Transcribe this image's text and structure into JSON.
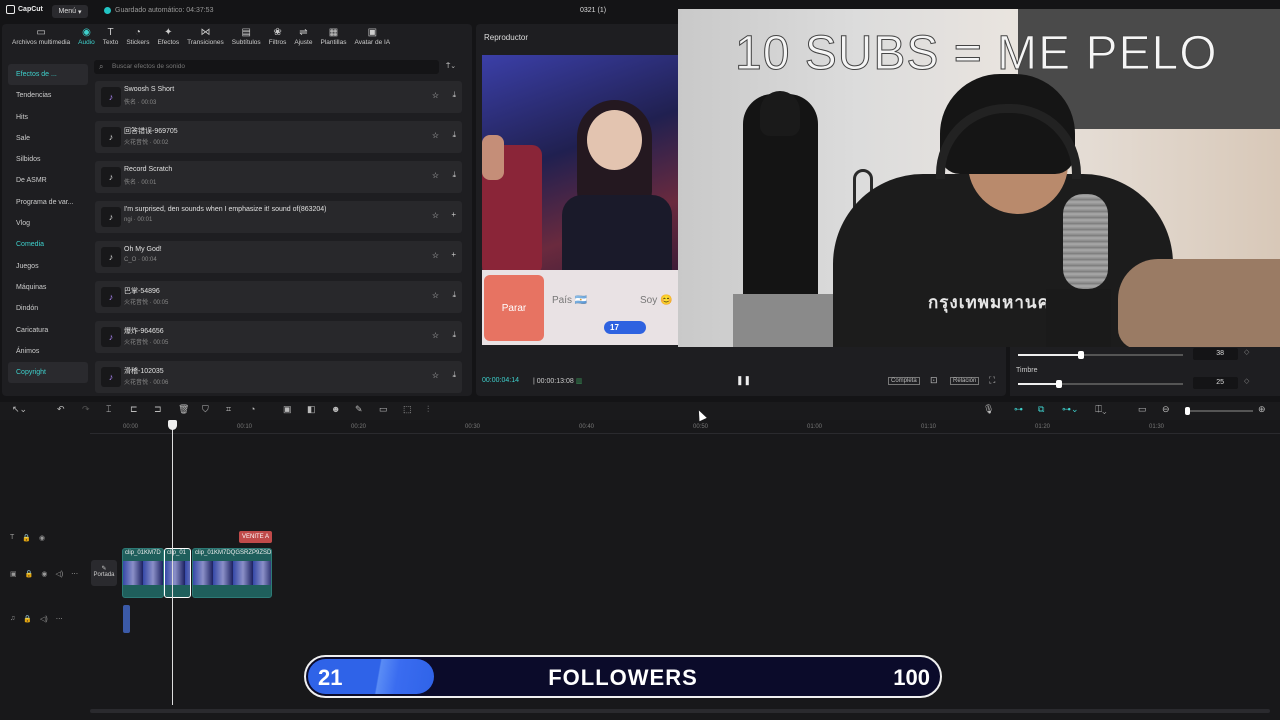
{
  "app": {
    "logo": "CapCut",
    "menu_label": "Menú",
    "autosave": "Guardado automático: 04:37:53",
    "project_name": "0321 (1)"
  },
  "tools": [
    {
      "label": "Archivos multimedia",
      "icon": "media-icon"
    },
    {
      "label": "Audio",
      "icon": "audio-icon"
    },
    {
      "label": "Texto",
      "icon": "text-icon"
    },
    {
      "label": "Stickers",
      "icon": "sticker-icon"
    },
    {
      "label": "Efectos",
      "icon": "effects-icon"
    },
    {
      "label": "Transiciones",
      "icon": "transition-icon"
    },
    {
      "label": "Subtítulos",
      "icon": "subtitle-icon"
    },
    {
      "label": "Filtros",
      "icon": "filter-icon"
    },
    {
      "label": "Ajuste",
      "icon": "adjust-icon"
    },
    {
      "label": "Plantillas",
      "icon": "template-icon"
    },
    {
      "label": "Avatar de IA",
      "icon": "avatar-icon"
    }
  ],
  "categories": [
    "Efectos de ...",
    "Tendencias",
    "Hits",
    "Sale",
    "Silbidos",
    "De ASMR",
    "Programa de var...",
    "Vlog",
    "Comedia",
    "Juegos",
    "Máquinas",
    "Dindón",
    "Caricatura",
    "Ánimos",
    "Copyright"
  ],
  "search_placeholder": "Buscar efectos de sonido",
  "sounds": [
    {
      "name": "Swoosh S Short",
      "meta": "佚名 · 00:03",
      "action": "download"
    },
    {
      "name": "回答错误-969705",
      "meta": "火花音悦 · 00:02",
      "action": "download"
    },
    {
      "name": "Record Scratch",
      "meta": "佚名 · 00:01",
      "action": "download"
    },
    {
      "name": "I'm surprised, den sounds when I emphasize it! sound of(863204)",
      "meta": "ngi · 00:01",
      "action": "add"
    },
    {
      "name": "Oh My God!",
      "meta": "C_O · 00:04",
      "action": "add"
    },
    {
      "name": "巴掌-54896",
      "meta": "火花音悦 · 00:05",
      "action": "download"
    },
    {
      "name": "爆炸-964656",
      "meta": "火花音悦 · 00:05",
      "action": "download"
    },
    {
      "name": "滑稽-102035",
      "meta": "火花音悦 · 00:06",
      "action": "download"
    }
  ],
  "player": {
    "title": "Reproductor",
    "current_time": "00:00:04:14",
    "total_time": "00:00:13:08",
    "btn_full": "Completa",
    "btn_ratio": "Relación",
    "video_buttons": {
      "stop": "Parar",
      "country": "País 🇦🇷",
      "soy": "Soy 😊",
      "counter": "17"
    }
  },
  "overlay_text": "10 SUBS = ME PELO",
  "shirt_text": "กรุงเทพมหานคร",
  "properties": {
    "value1": "38",
    "timbre_label": "Timbre",
    "value2": "25",
    "value1_fraction": 0.38,
    "value2_fraction": 0.25
  },
  "ruler": [
    "00:00",
    "00:10",
    "00:20",
    "00:30",
    "00:40",
    "00:50",
    "01:00",
    "01:10",
    "01:20",
    "01:30"
  ],
  "timeline": {
    "cover_label": "Portada",
    "text_clip": "VENITE A",
    "clips": [
      "clip_01KM7D",
      "clip_01",
      "clip_01KM7DQGSRZP9ZSD"
    ]
  },
  "followers": {
    "current": "21",
    "label": "FOLLOWERS",
    "goal": "100",
    "progress": 0.21
  },
  "colors": {
    "accent": "#3ed0cc",
    "progress_blue": "#2f63e8",
    "text_clip": "#c04a4a"
  }
}
